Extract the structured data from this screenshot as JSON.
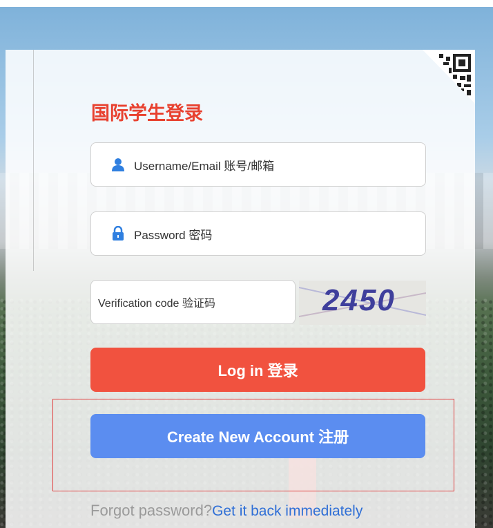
{
  "title": "国际学生登录",
  "username": {
    "placeholder": "Username/Email 账号/邮箱",
    "icon": "user-icon"
  },
  "password": {
    "placeholder": "Password 密码",
    "icon": "lock-icon"
  },
  "verification": {
    "placeholder": "Verification code 验证码",
    "captcha_text": "2450"
  },
  "buttons": {
    "login": "Log in 登录",
    "create": "Create New Account 注册"
  },
  "forgot": {
    "text": "Forgot password?",
    "link": "Get it back immediately"
  },
  "colors": {
    "title": "#e8412f",
    "login": "#f1523f",
    "create": "#5b8df0",
    "icon": "#2f7fe0",
    "highlight": "#e03c3c"
  }
}
